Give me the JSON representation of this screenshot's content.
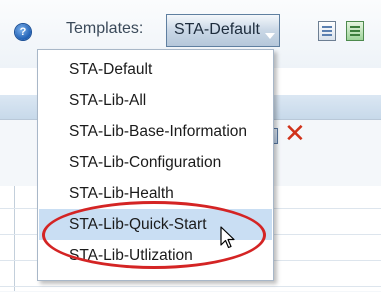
{
  "toolbar": {
    "help_glyph": "?",
    "templates_label": "Templates:",
    "template_select": {
      "value": "STA-Default"
    }
  },
  "dropdown": {
    "options": [
      "STA-Default",
      "STA-Lib-All",
      "STA-Lib-Base-Information",
      "STA-Lib-Configuration",
      "STA-Lib-Health",
      "STA-Lib-Quick-Start",
      "STA-Lib-Utlization"
    ],
    "hovered_option": "STA-Lib-Quick-Start"
  },
  "annotation": {
    "ellipse_color": "#d42424"
  },
  "icons": [
    "help-icon",
    "save-template-icon",
    "export-template-icon",
    "panel-popout-icon",
    "close-icon",
    "mouse-cursor-icon"
  ],
  "colors": {
    "highlight": "#c9def3",
    "close": "#d0321a"
  }
}
